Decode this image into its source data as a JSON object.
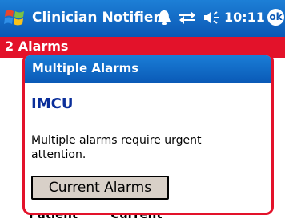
{
  "titlebar": {
    "app_title": "Clinician Notifier",
    "time": "10:11",
    "ok_label": "ok",
    "icons": [
      "windows-start-icon",
      "notification-bell-icon",
      "connectivity-icon",
      "volume-icon"
    ]
  },
  "alarms_strip": {
    "label": "2 Alarms",
    "color": "#e3122a"
  },
  "dialog": {
    "title": "Multiple Alarms",
    "unit": "IMCU",
    "message": "Multiple alarms require urgent attention.",
    "button_label": "Current Alarms"
  },
  "underlay": {
    "col_patient": "Patient",
    "col_current": "Current"
  },
  "colors": {
    "titlebar_blue": "#0b58b5",
    "alarm_red": "#e3122a",
    "unit_text": "#0a2e9a",
    "button_bg": "#d8d0c8"
  }
}
